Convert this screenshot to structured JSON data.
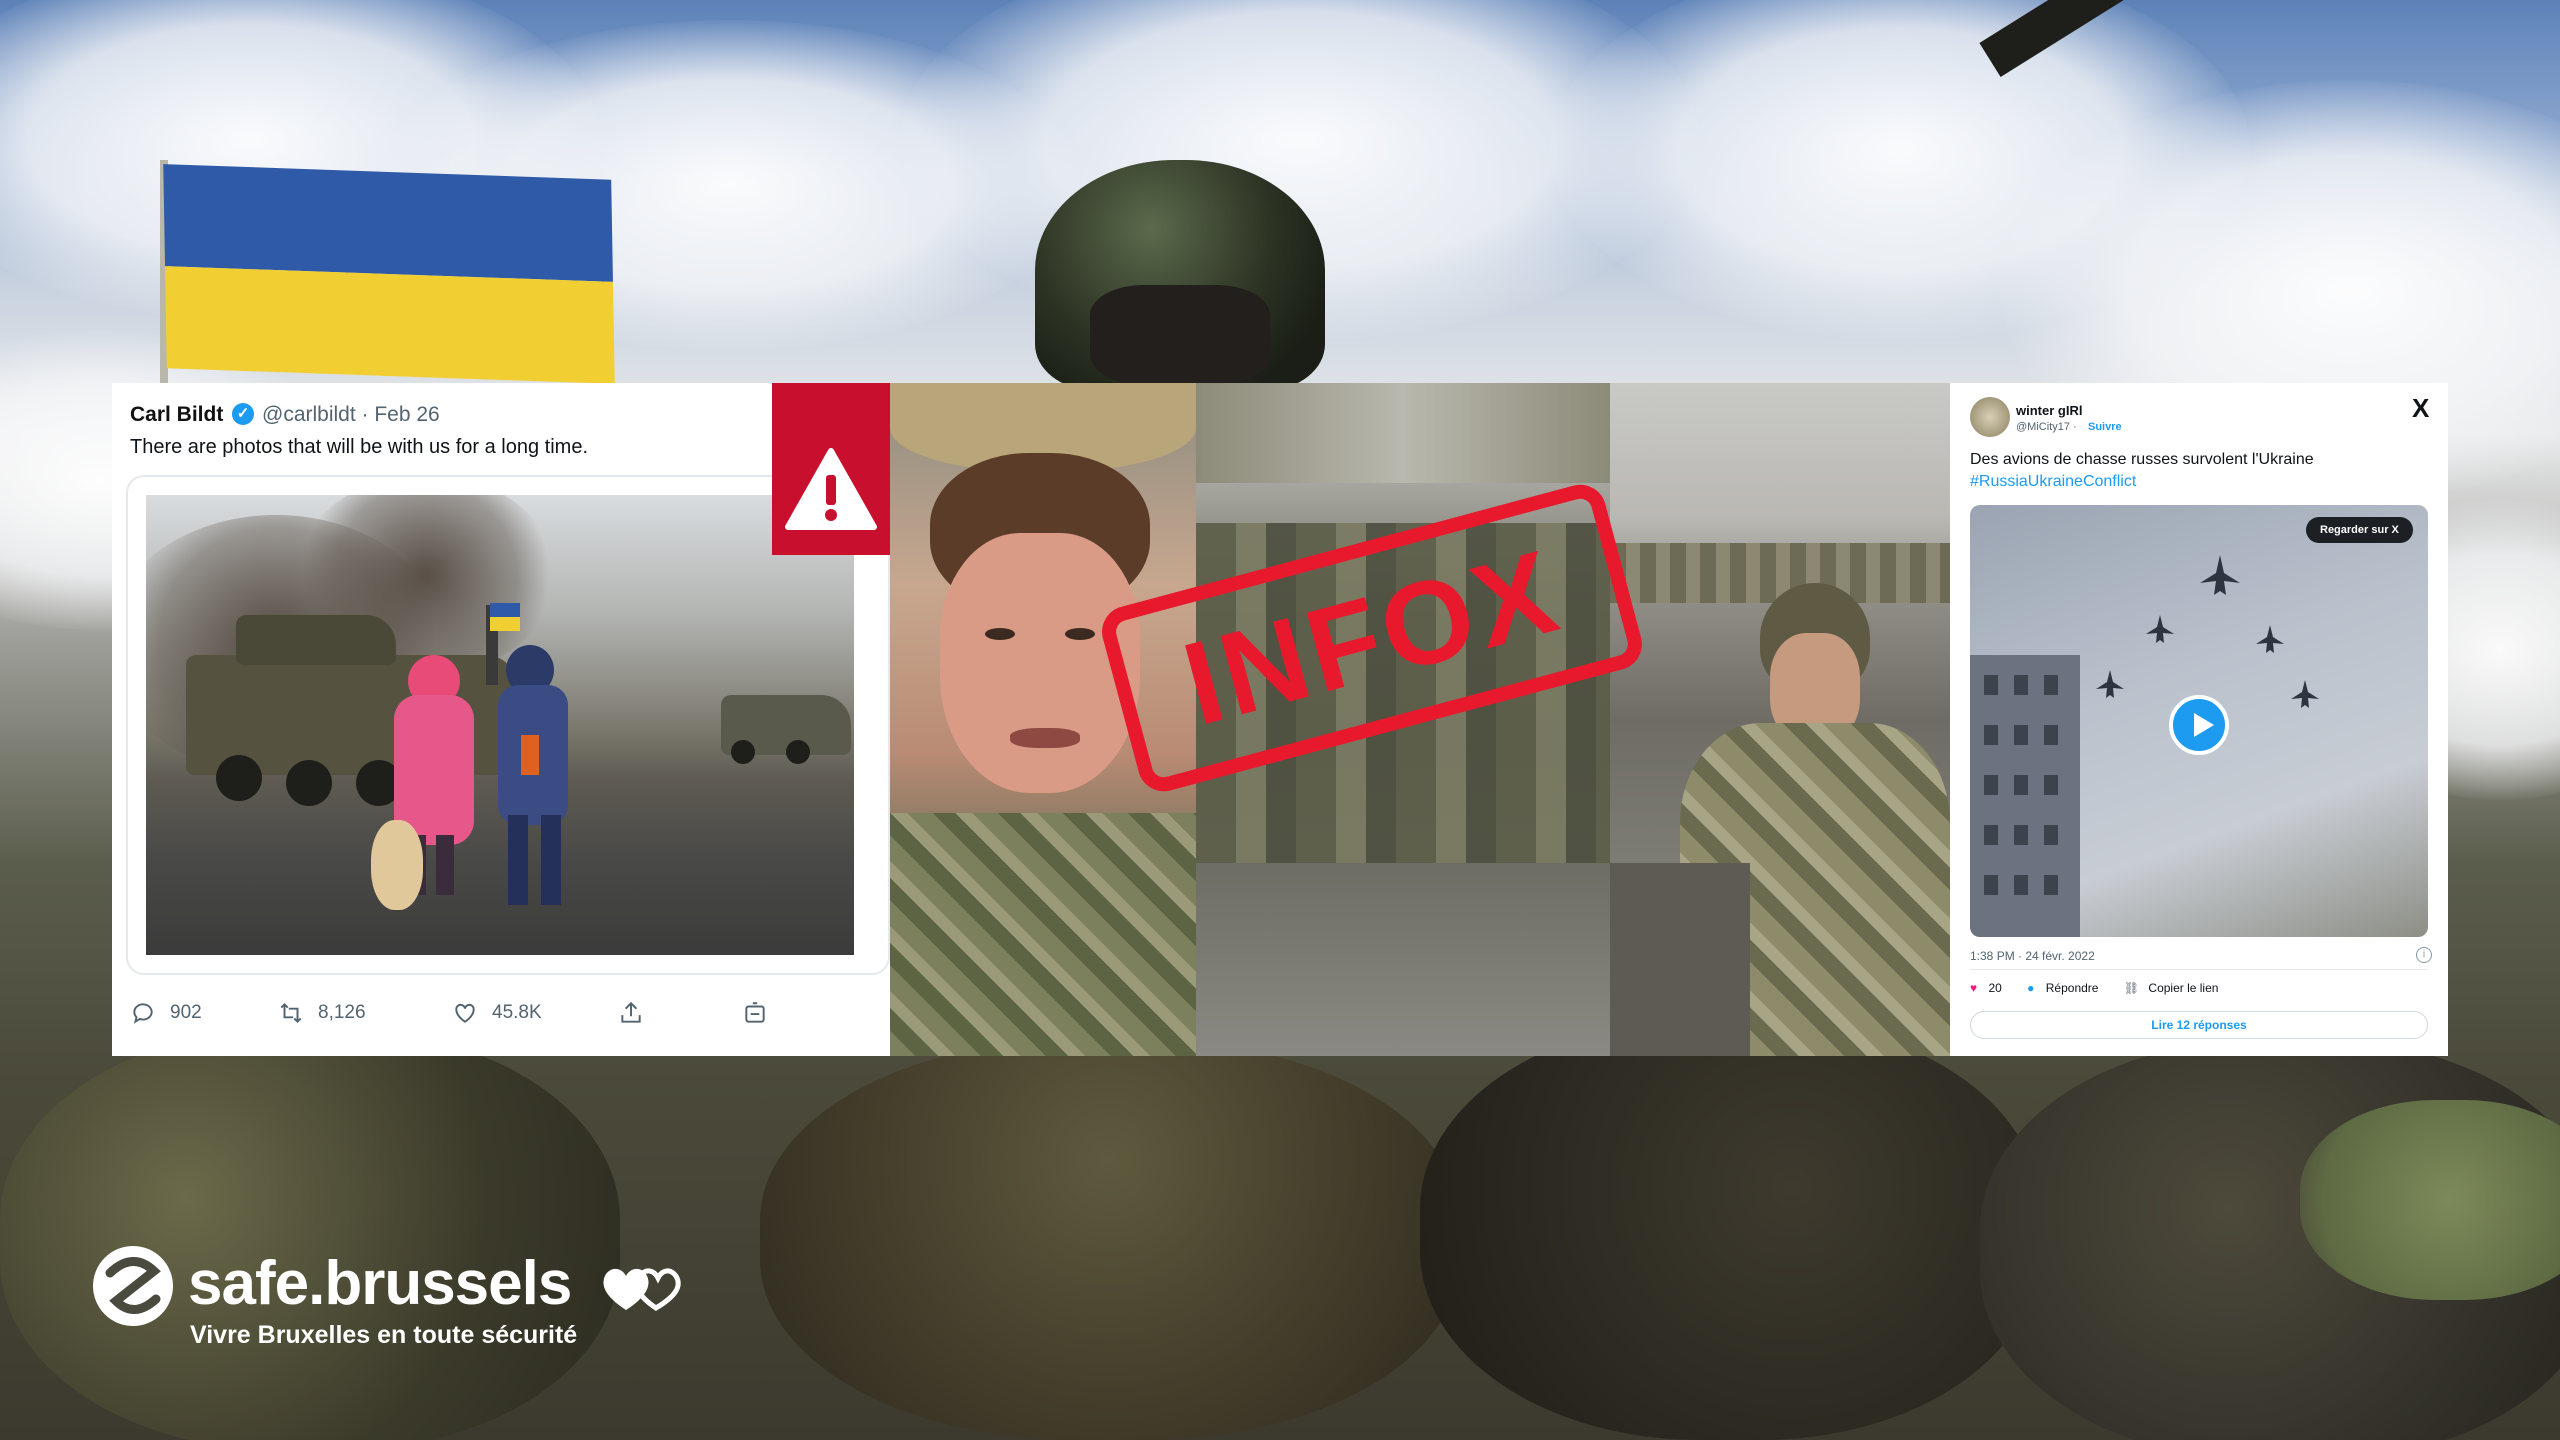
{
  "tweet": {
    "author": "Carl Bildt",
    "handle_date": "@carlbildt · Feb 26",
    "text": "There are photos that will be with us for a long time.",
    "replies": "902",
    "retweets": "8,126",
    "likes": "45.8K",
    "icons": [
      "reply-icon",
      "retweet-icon",
      "like-icon",
      "share-icon",
      "analytics-icon"
    ]
  },
  "stamp": {
    "text": "INFOX",
    "color": "#e8192c"
  },
  "warning": {
    "icon": "warning-triangle-icon",
    "color": "#c8102e"
  },
  "post": {
    "name": "winter gIRl",
    "handle": "@MiCity17 ·",
    "follow": "Suivre",
    "close": "X",
    "text": "Des avions de chasse russes survolent l'Ukraine",
    "hashtag": "#RussiaUkraineConflict",
    "watch_label": "Regarder sur X",
    "date": "1:38 PM · 24 févr. 2022",
    "likes": "20",
    "reply_label": "Répondre",
    "copy_label": "Copier le lien",
    "read_replies": "Lire 12 réponses"
  },
  "logo": {
    "name": "safe.brussels",
    "tagline": "Vivre Bruxelles en toute sécurité"
  },
  "colors": {
    "ukraine_blue": "#2e5aa8",
    "ukraine_yellow": "#f1cf33",
    "twitter_blue": "#1d9bf0"
  }
}
